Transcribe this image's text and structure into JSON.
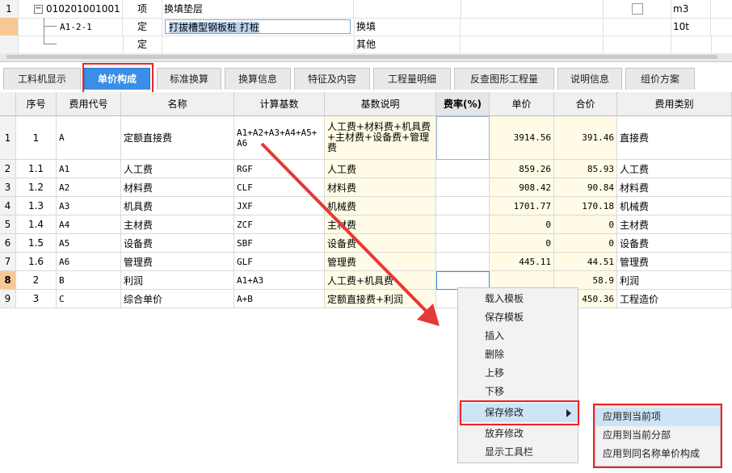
{
  "top_rows": [
    {
      "num": "1",
      "code": "010201001001",
      "kind": "项",
      "name": "换填垫层",
      "mode": "",
      "unit": "m3"
    },
    {
      "num": "",
      "code": "A1-2-1",
      "kind": "定",
      "name": "打拔槽型钢板桩 打桩",
      "mode": "换填",
      "unit": "10t"
    },
    {
      "num": "",
      "code": "",
      "kind": "定",
      "name": "",
      "mode": "其他",
      "unit": ""
    }
  ],
  "tabs": [
    "工料机显示",
    "单价构成",
    "标准换算",
    "换算信息",
    "特征及内容",
    "工程量明细",
    "反查图形工程量",
    "说明信息",
    "组价方案"
  ],
  "active_tab_index": 1,
  "columns": [
    "序号",
    "费用代号",
    "名称",
    "计算基数",
    "基数说明",
    "费率(%)",
    "单价",
    "合价",
    "费用类别"
  ],
  "rows": [
    {
      "rn": "1",
      "seq": "1",
      "code": "A",
      "name": "定额直接费",
      "base": "A1+A2+A3+A4+A5+A6",
      "desc": "人工费+材料费+机具费+主材费+设备费+管理费",
      "rate": "",
      "price": "3914.56",
      "total": "391.46",
      "cat": "直接费"
    },
    {
      "rn": "2",
      "seq": "1.1",
      "code": "A1",
      "name": "人工费",
      "base": "RGF",
      "desc": "人工费",
      "rate": "",
      "price": "859.26",
      "total": "85.93",
      "cat": "人工费"
    },
    {
      "rn": "3",
      "seq": "1.2",
      "code": "A2",
      "name": "材料费",
      "base": "CLF",
      "desc": "材料费",
      "rate": "",
      "price": "908.42",
      "total": "90.84",
      "cat": "材料费"
    },
    {
      "rn": "4",
      "seq": "1.3",
      "code": "A3",
      "name": "机具费",
      "base": "JXF",
      "desc": "机械费",
      "rate": "",
      "price": "1701.77",
      "total": "170.18",
      "cat": "机械费"
    },
    {
      "rn": "5",
      "seq": "1.4",
      "code": "A4",
      "name": "主材费",
      "base": "ZCF",
      "desc": "主材费",
      "rate": "",
      "price": "0",
      "total": "0",
      "cat": "主材费"
    },
    {
      "rn": "6",
      "seq": "1.5",
      "code": "A5",
      "name": "设备费",
      "base": "SBF",
      "desc": "设备费",
      "rate": "",
      "price": "0",
      "total": "0",
      "cat": "设备费"
    },
    {
      "rn": "7",
      "seq": "1.6",
      "code": "A6",
      "name": "管理费",
      "base": "GLF",
      "desc": "管理费",
      "rate": "",
      "price": "445.11",
      "total": "44.51",
      "cat": "管理费"
    },
    {
      "rn": "8",
      "seq": "2",
      "code": "B",
      "name": "利润",
      "base": "A1+A3",
      "desc": "人工费+机具费",
      "rate": "",
      "price": "",
      "total": "58.9",
      "cat": "利润"
    },
    {
      "rn": "9",
      "seq": "3",
      "code": "C",
      "name": "综合单价",
      "base": "A+B",
      "desc": "定额直接费+利润",
      "rate": "",
      "price": "",
      "total": "450.36",
      "cat": "工程造价"
    }
  ],
  "context_menu": [
    "载入模板",
    "保存模板",
    "插入",
    "删除",
    "上移",
    "下移",
    "保存修改",
    "放弃修改",
    "显示工具栏"
  ],
  "submenu": [
    "应用到当前项",
    "应用到当前分部",
    "应用到同名称单价构成"
  ],
  "colors": {
    "accent": "#3a8ee6",
    "highlight_box": "#e22222",
    "arrow": "#e53935",
    "yellow_cell": "#fffbe6"
  }
}
